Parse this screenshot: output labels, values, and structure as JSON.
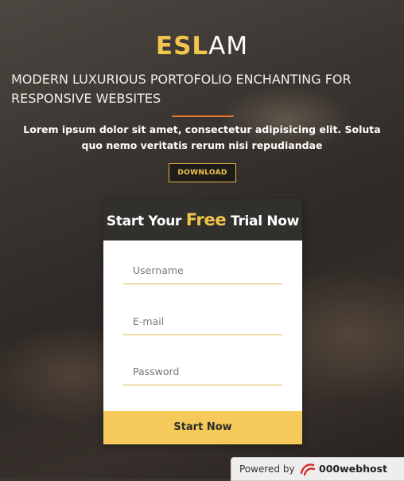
{
  "hero": {
    "logo_highlight": "ESL",
    "logo_rest": "AM",
    "tagline": "MODERN LUXURIOUS PORTOFOLIO ENCHANTING FOR RESPONSIVE WEBSITES",
    "lead": "Lorem ipsum dolor sit amet, consectetur adipisicing elit. Soluta quo nemo veritatis rerum nisi repudiandae",
    "download_label": "DOWNLOAD"
  },
  "trial_form": {
    "title_before": "Start Your ",
    "title_highlight": "Free",
    "title_after": " Trial Now",
    "username_placeholder": "Username",
    "email_placeholder": "E-mail",
    "password_placeholder": "Password",
    "submit_label": "Start Now"
  },
  "footer_badge": {
    "powered_label": "Powered by",
    "brand": "000webhost",
    "icon": "webhost-logo-icon"
  },
  "colors": {
    "accent": "#f2c54b",
    "rule": "#e8782a",
    "card_header": "#32302d",
    "submit": "#f5c95a"
  }
}
